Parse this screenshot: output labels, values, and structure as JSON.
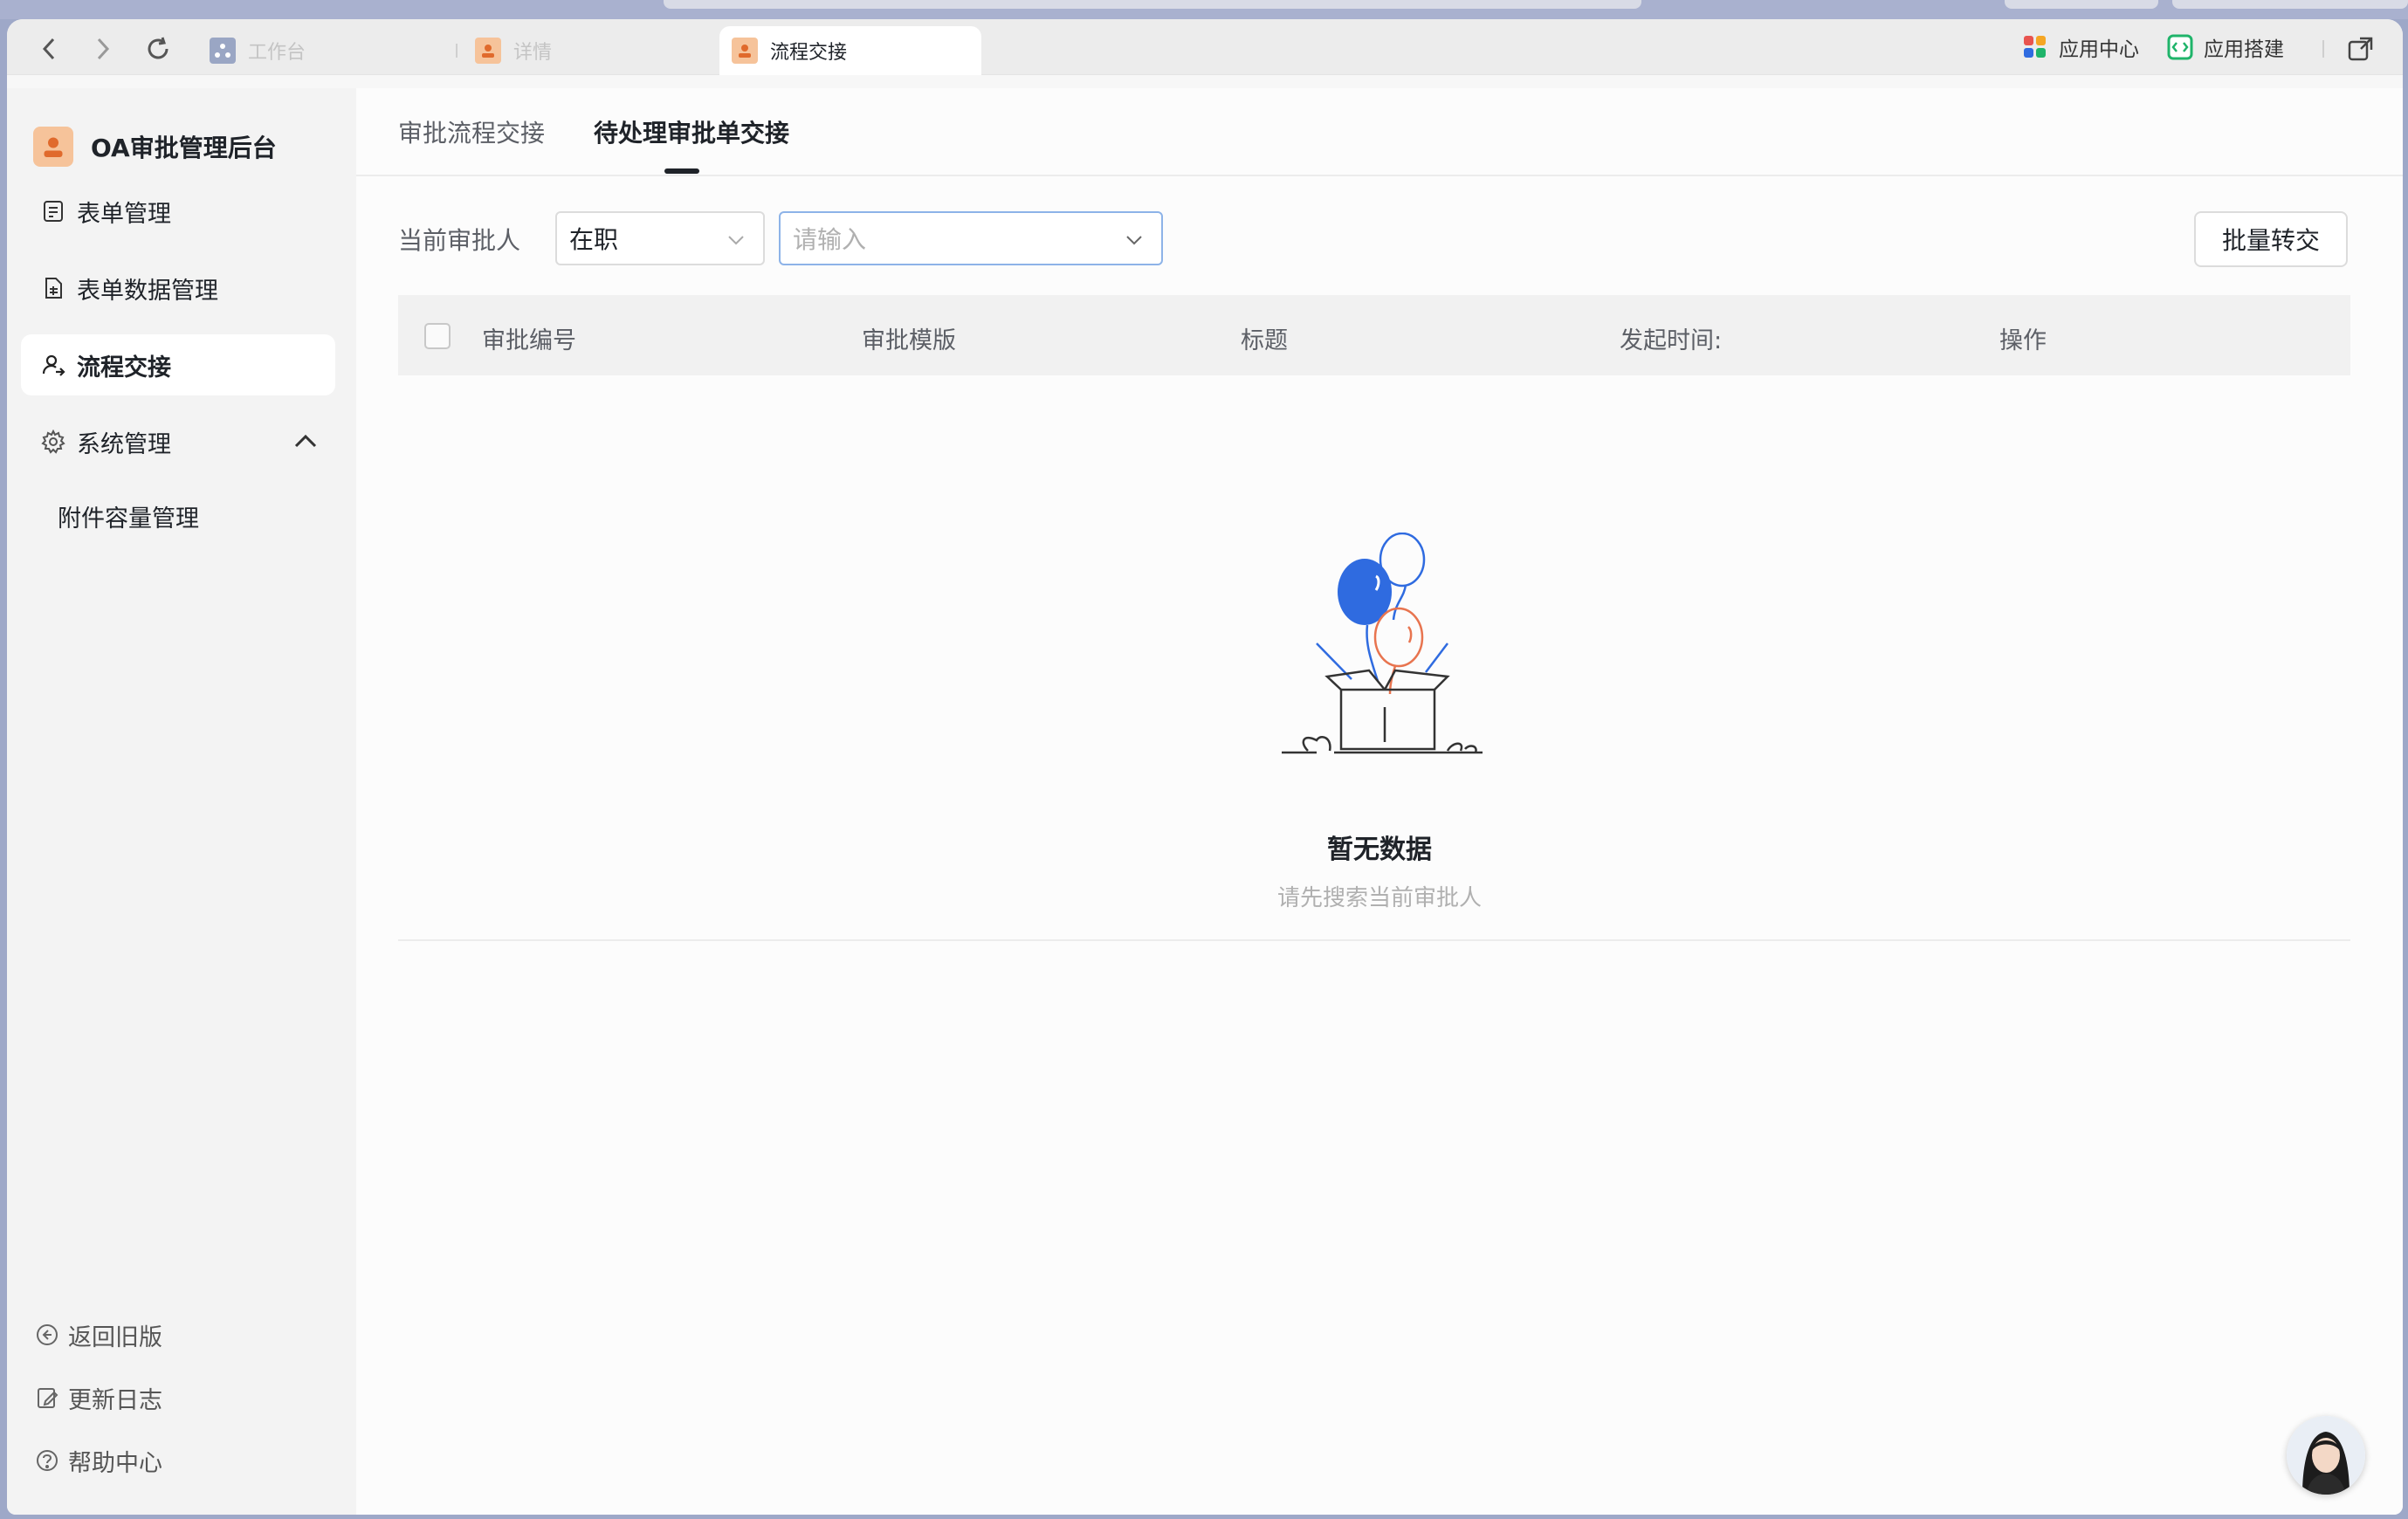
{
  "titlebar": {
    "tabs": [
      {
        "label": "工作台",
        "icon": "workspace-icon",
        "active": false
      },
      {
        "label": "详情",
        "icon": "person-icon",
        "active": false
      },
      {
        "label": "流程交接",
        "icon": "person-icon",
        "active": true
      }
    ],
    "right_links": [
      {
        "label": "应用中心",
        "icon": "app-grid-icon"
      },
      {
        "label": "应用搭建",
        "icon": "code-icon"
      }
    ]
  },
  "sidebar": {
    "brand": "OA审批管理后台",
    "items": [
      {
        "label": "表单管理",
        "icon": "form-icon",
        "active": false
      },
      {
        "label": "表单数据管理",
        "icon": "data-file-icon",
        "active": false
      },
      {
        "label": "流程交接",
        "icon": "user-transfer-icon",
        "active": true
      },
      {
        "label": "系统管理",
        "icon": "gear-icon",
        "active": false,
        "expanded": true
      }
    ],
    "submenu": [
      {
        "label": "附件容量管理"
      }
    ],
    "bottom": [
      {
        "label": "返回旧版",
        "icon": "back-circle-icon"
      },
      {
        "label": "更新日志",
        "icon": "edit-log-icon"
      },
      {
        "label": "帮助中心",
        "icon": "help-icon"
      }
    ]
  },
  "main": {
    "tabs": [
      {
        "label": "审批流程交接",
        "active": false
      },
      {
        "label": "待处理审批单交接",
        "active": true
      }
    ],
    "filter": {
      "label": "当前审批人",
      "status_value": "在职",
      "search_placeholder": "请输入"
    },
    "batch_button": "批量转交",
    "table": {
      "columns": [
        "审批编号",
        "审批模版",
        "标题",
        "发起时间:",
        "操作"
      ],
      "rows": []
    },
    "empty": {
      "title": "暂无数据",
      "subtitle": "请先搜索当前审批人"
    }
  },
  "colors": {
    "balloon_blue": "#2f6be0",
    "balloon_orange": "#e8744f",
    "active_bg": "#ffffff"
  }
}
